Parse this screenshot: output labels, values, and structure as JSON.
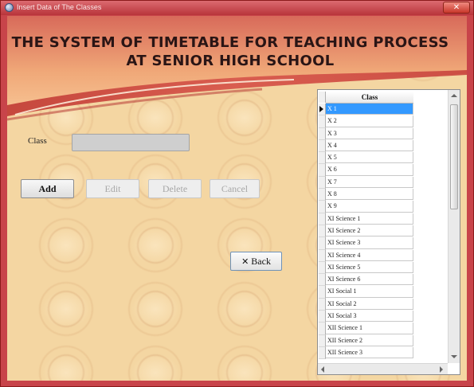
{
  "window": {
    "title": "Insert Data of The Classes",
    "close_glyph": "✕"
  },
  "header": {
    "title_line1": "THE SYSTEM OF TIMETABLE FOR TEACHING PROCESS",
    "title_line2": "AT SENIOR HIGH SCHOOL"
  },
  "form": {
    "class_label": "Class",
    "class_value": ""
  },
  "buttons": {
    "add": "Add",
    "edit": "Edit",
    "delete": "Delete",
    "cancel": "Cancel",
    "back": "Back",
    "back_icon": "✕"
  },
  "grid": {
    "column_header": "Class",
    "selected_index": 0,
    "rows": [
      "X 1",
      "X 2",
      "X 3",
      "X 4",
      "X 5",
      "X 6",
      "X 7",
      "X 8",
      "X 9",
      "XI Science 1",
      "XI Science 2",
      "XI Science 3",
      "XI Science 4",
      "XI Science 5",
      "XI Science 6",
      "XI Social 1",
      "XI Social 2",
      "XI Social 3",
      "XII Science 1",
      "XII Science 2",
      "XII Science 3"
    ]
  },
  "colors": {
    "accent": "#c8444a",
    "selection": "#3399ff",
    "background": "#f4d6a2"
  }
}
